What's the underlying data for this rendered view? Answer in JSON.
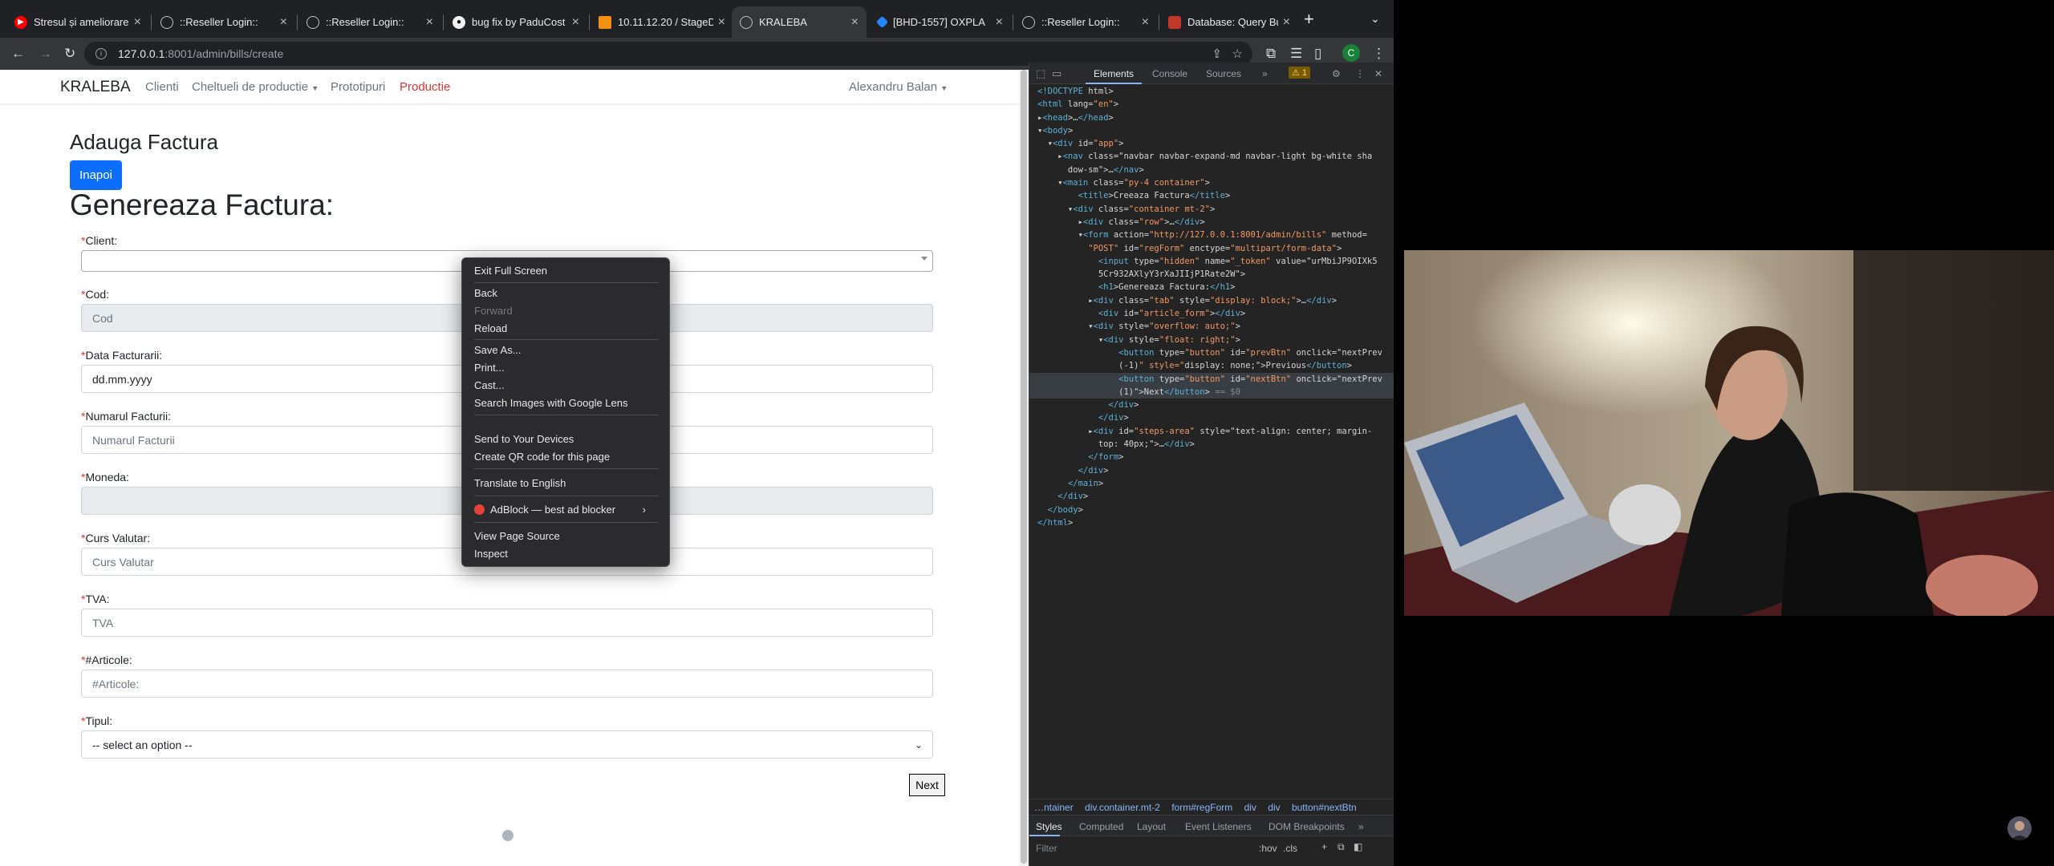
{
  "tabs": [
    {
      "title": "Stresul și ameliorare",
      "favicon": "youtube-icon"
    },
    {
      "title": "::Reseller Login::",
      "favicon": "globe-icon"
    },
    {
      "title": "::Reseller Login::",
      "favicon": "globe-icon"
    },
    {
      "title": "bug fix by PaduCost",
      "favicon": "github-icon"
    },
    {
      "title": "10.11.12.20 / StageD",
      "favicon": "phpmyadmin-icon"
    },
    {
      "title": "KRALEBA",
      "favicon": "globe-icon",
      "active": true
    },
    {
      "title": "[BHD-1557] OXPLA",
      "favicon": "jira-icon"
    },
    {
      "title": "::Reseller Login::",
      "favicon": "globe-icon"
    },
    {
      "title": "Database: Query Bu",
      "favicon": "adminer-icon"
    }
  ],
  "address": {
    "host": "127.0.0.1",
    "path": ":8001/admin/bills/create"
  },
  "profile_initial": "C",
  "navbar": {
    "brand": "KRALEBA",
    "links": [
      "Clienti",
      "Cheltueli de productie",
      "Prototipuri",
      "Productie"
    ],
    "user": "Alexandru Balan"
  },
  "page": {
    "subtitle": "Adauga Factura",
    "back_label": "Inapoi",
    "heading": "Genereaza Factura:",
    "next_label": "Next"
  },
  "form": {
    "client_label": "Client:",
    "cod_label": "Cod:",
    "cod_placeholder": "Cod",
    "data_label": "Data Facturarii:",
    "data_value": "dd.mm.yyyy",
    "numar_label": "Numarul Facturii:",
    "numar_placeholder": "Numarul Facturii",
    "moneda_label": "Moneda:",
    "curs_label": "Curs Valutar:",
    "curs_placeholder": "Curs Valutar",
    "tva_label": "TVA:",
    "tva_placeholder": "TVA",
    "articole_label": "#Articole:",
    "articole_placeholder": "#Articole:",
    "tipul_label": "Tipul:",
    "tipul_value": "-- select an option --"
  },
  "context_menu": {
    "exit_fullscreen": "Exit Full Screen",
    "back": "Back",
    "forward": "Forward",
    "reload": "Reload",
    "save_as": "Save As...",
    "print": "Print...",
    "cast": "Cast...",
    "search_lens": "Search Images with Google Lens",
    "send_devices": "Send to Your Devices",
    "qr": "Create QR code for this page",
    "translate": "Translate to English",
    "adblock": "AdBlock — best ad blocker",
    "view_source": "View Page Source",
    "inspect": "Inspect"
  },
  "devtools": {
    "tabs": [
      "Elements",
      "Console",
      "Sources"
    ],
    "warnings": "1",
    "dom": [
      "<!DOCTYPE html>",
      "<html lang=\"en\">",
      "▸<head>…</head>",
      "▾<body>",
      "  ▾<div id=\"app\">",
      "    ▸<nav class=\"navbar navbar-expand-md navbar-light bg-white sha",
      "      dow-sm\">…</nav>",
      "    ▾<main class=\"py-4 container\">",
      "        <title>Creeaza Factura</title>",
      "      ▾<div class=\"container mt-2\">",
      "        ▸<div class=\"row\">…</div>",
      "        ▾<form action=\"http://127.0.0.1:8001/admin/bills\" method=",
      "          \"POST\" id=\"regForm\" enctype=\"multipart/form-data\">",
      "            <input type=\"hidden\" name=\"_token\" value=\"urMbiJP9OIXk5",
      "            5Cr932AXlyY3rXaJIIjP1Rate2W\">",
      "            <h1>Genereaza Factura:</h1>",
      "          ▸<div class=\"tab\" style=\"display: block;\">…</div>",
      "            <div id=\"article_form\"></div>",
      "          ▾<div style=\"overflow: auto;\">",
      "            ▾<div style=\"float: right;\">",
      "                <button type=\"button\" id=\"prevBtn\" onclick=\"nextPrev",
      "                (-1)\" style=\"display: none;\">Previous</button>",
      "                <button type=\"button\" id=\"nextBtn\" onclick=\"nextPrev",
      "                (1)\">Next</button> == $0",
      "              </div>",
      "            </div>",
      "          ▸<div id=\"steps-area\" style=\"text-align: center; margin-",
      "            top: 40px;\">…</div>",
      "          </form>",
      "        </div>",
      "      </main>",
      "    </div>",
      "  </body>",
      "</html>"
    ],
    "breadcrumbs": [
      "…ntainer",
      "div.container.mt-2",
      "form#regForm",
      "div",
      "div",
      "button#nextBtn"
    ],
    "style_tabs": [
      "Styles",
      "Computed",
      "Layout",
      "Event Listeners",
      "DOM Breakpoints"
    ],
    "filter_placeholder": "Filter",
    "hov": ":hov",
    "cls": ".cls"
  }
}
